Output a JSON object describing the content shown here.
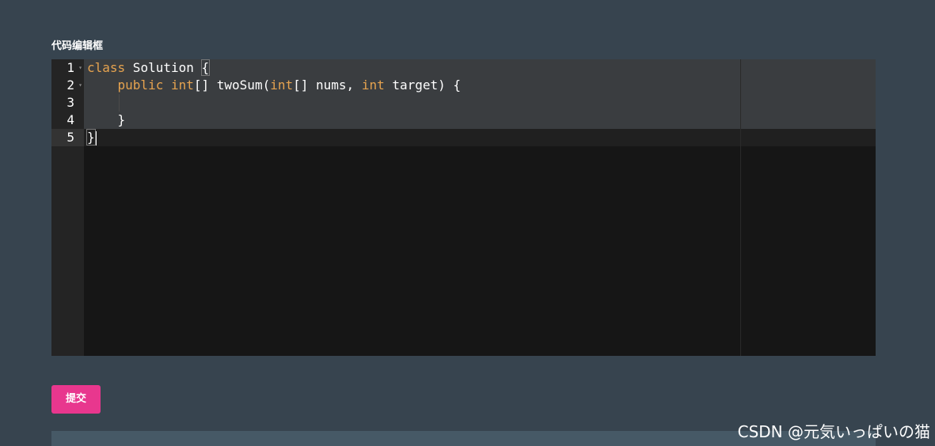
{
  "editor_section": {
    "label": "代码编辑框"
  },
  "editor": {
    "line_numbers": [
      "1",
      "2",
      "3",
      "4",
      "5"
    ],
    "active_line": 5,
    "foldable_lines": [
      1,
      2
    ],
    "fold_icon": "caret-down-icon",
    "lines": [
      [
        {
          "t": "class",
          "k": "kw"
        },
        {
          "t": " Solution ",
          "k": "plain"
        },
        {
          "t": "{",
          "k": "plain",
          "box": true
        }
      ],
      [
        {
          "t": "    ",
          "k": "plain"
        },
        {
          "t": "public",
          "k": "kw"
        },
        {
          "t": " ",
          "k": "plain"
        },
        {
          "t": "int",
          "k": "kw"
        },
        {
          "t": "[] twoSum(",
          "k": "plain"
        },
        {
          "t": "int",
          "k": "kw"
        },
        {
          "t": "[] nums, ",
          "k": "plain"
        },
        {
          "t": "int",
          "k": "kw"
        },
        {
          "t": " target) {",
          "k": "plain"
        }
      ],
      [
        {
          "t": "",
          "k": "plain"
        }
      ],
      [
        {
          "t": "    }",
          "k": "plain"
        }
      ],
      [
        {
          "t": "}",
          "k": "plain",
          "box": true
        }
      ]
    ],
    "colors": {
      "keyword": "#e6a34f",
      "text": "#ffffff",
      "background": "#161616",
      "gutter": "#242424"
    }
  },
  "actions": {
    "submit_label": "提交",
    "submit_color": "#e8378e"
  },
  "watermark": {
    "text": "CSDN @元気いっぱいの猫"
  }
}
